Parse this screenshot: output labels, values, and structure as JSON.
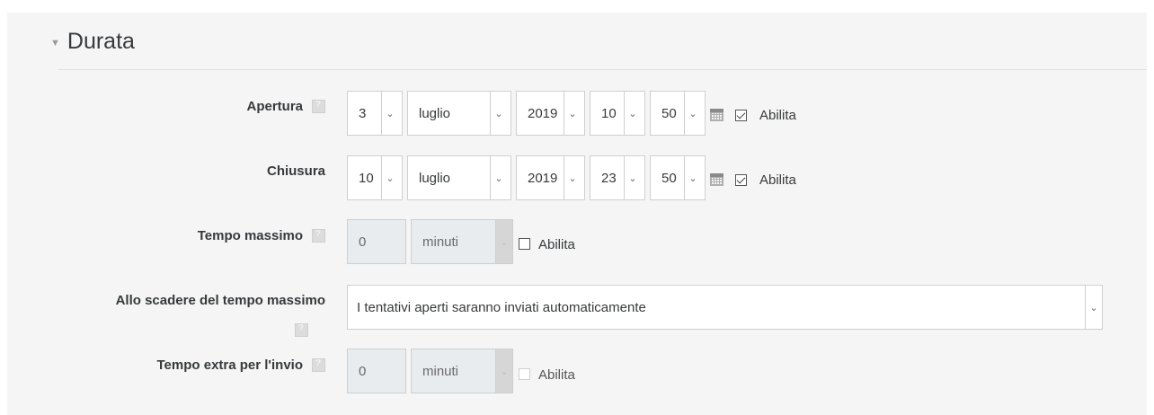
{
  "section": {
    "title": "Durata"
  },
  "apertura": {
    "label": "Apertura",
    "day": "3",
    "month": "luglio",
    "year": "2019",
    "hour": "10",
    "minute": "50",
    "enable_label": "Abilita",
    "enabled": true
  },
  "chiusura": {
    "label": "Chiusura",
    "day": "10",
    "month": "luglio",
    "year": "2019",
    "hour": "23",
    "minute": "50",
    "enable_label": "Abilita",
    "enabled": true
  },
  "tempo_massimo": {
    "label": "Tempo massimo",
    "value": "0",
    "unit": "minuti",
    "enable_label": "Abilita",
    "enabled": false
  },
  "scadenza": {
    "label": "Allo scadere del tempo massimo",
    "selected": "I tentativi aperti saranno inviati automaticamente"
  },
  "tempo_extra": {
    "label": "Tempo extra per l'invio",
    "value": "0",
    "unit": "minuti",
    "enable_label": "Abilita",
    "enabled": false
  }
}
